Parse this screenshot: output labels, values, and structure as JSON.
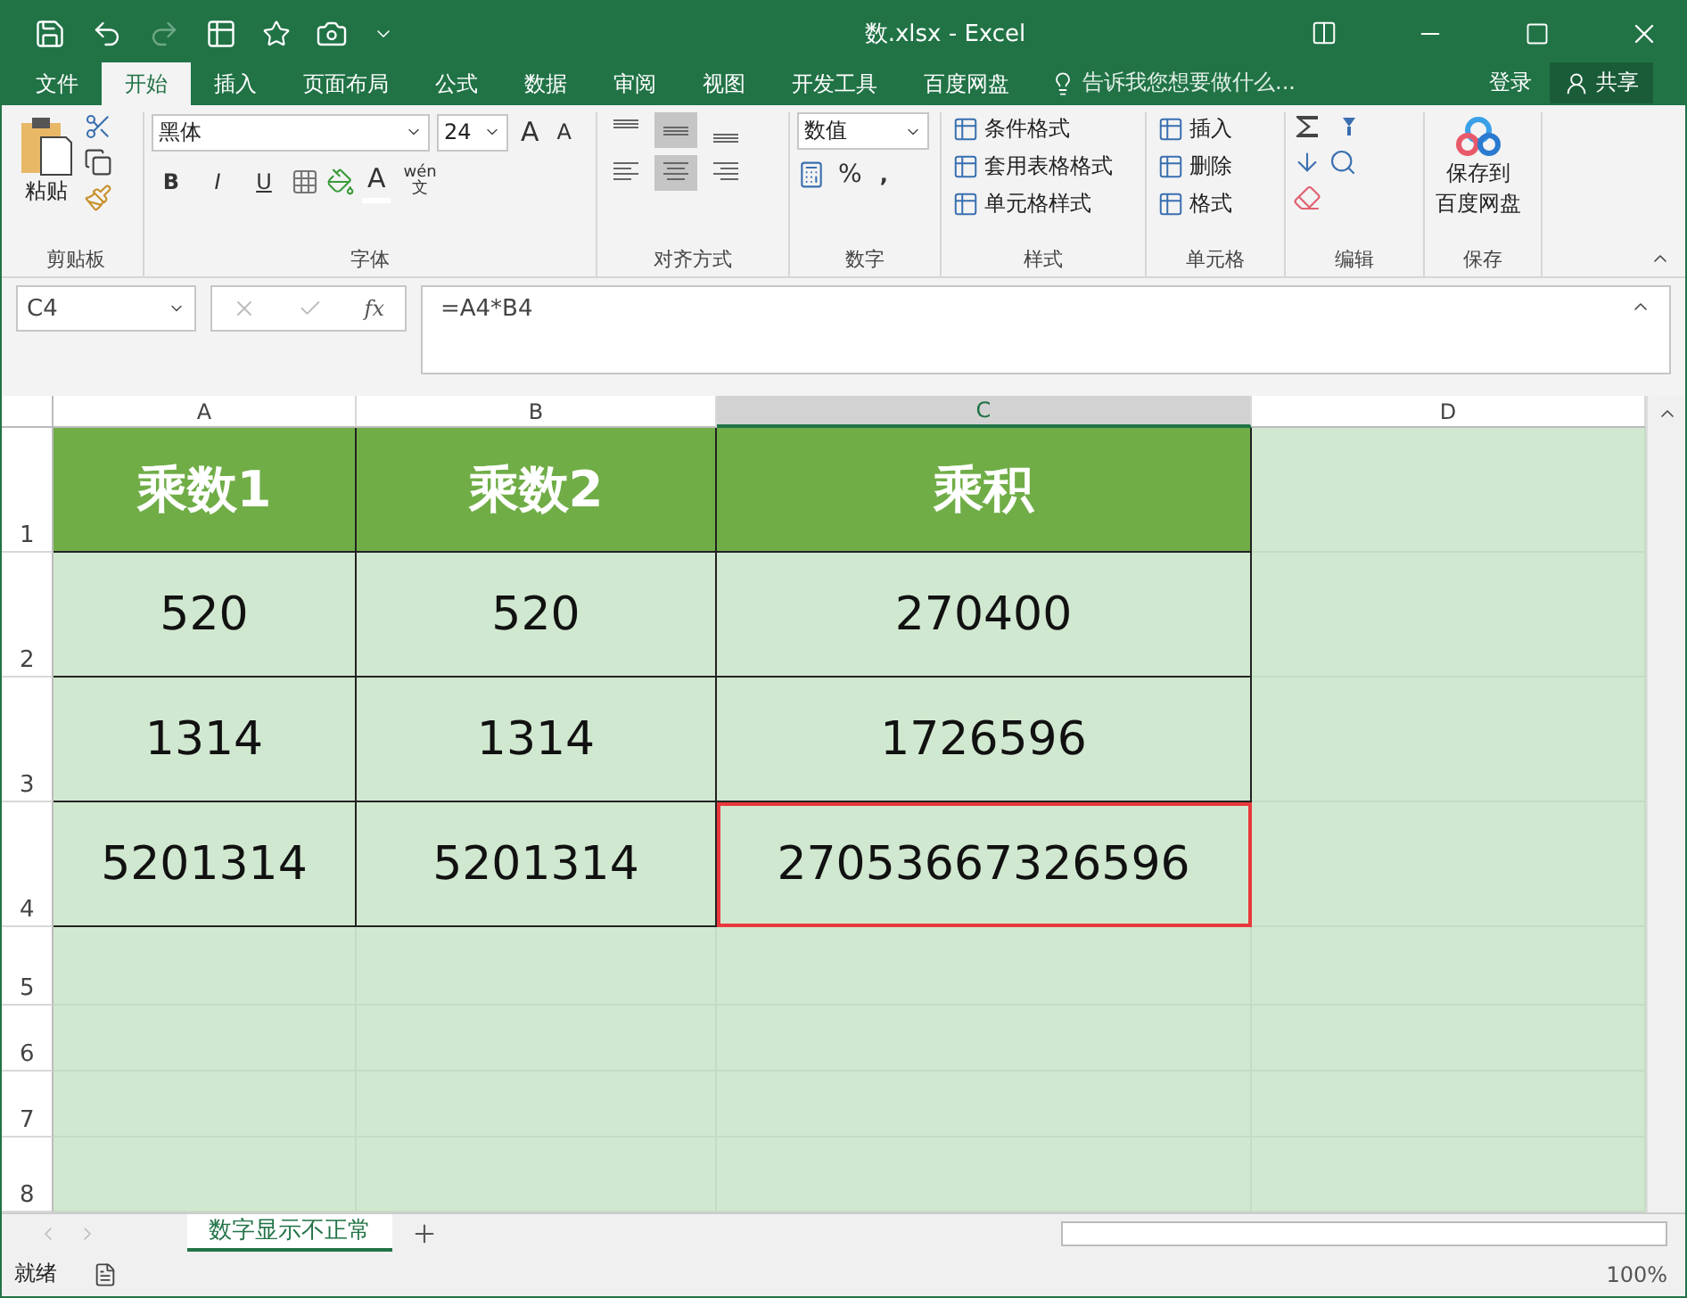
{
  "window": {
    "title": "数.xlsx - Excel"
  },
  "menu_tabs": [
    {
      "label": "文件",
      "selected": false
    },
    {
      "label": "开始",
      "selected": true
    },
    {
      "label": "插入",
      "selected": false
    },
    {
      "label": "页面布局",
      "selected": false
    },
    {
      "label": "公式",
      "selected": false
    },
    {
      "label": "数据",
      "selected": false
    },
    {
      "label": "审阅",
      "selected": false
    },
    {
      "label": "视图",
      "selected": false
    },
    {
      "label": "开发工具",
      "selected": false
    },
    {
      "label": "百度网盘",
      "selected": false
    }
  ],
  "tell_me": "告诉我您想要做什么...",
  "sign_in": "登录",
  "share": "共享",
  "clipboard": {
    "label": "剪贴板",
    "paste": "粘贴"
  },
  "font": {
    "label": "字体",
    "font_name": "黑体",
    "font_size": "24",
    "grow": "A",
    "shrink": "A",
    "styles": [
      "B",
      "I",
      "U"
    ],
    "font_color": "A",
    "phonetic_top": "wén",
    "phonetic_bottom": "文"
  },
  "alignment": {
    "label": "对齐方式",
    "vertical": [
      {
        "selected": false
      },
      {
        "selected": true
      },
      {
        "selected": false
      }
    ],
    "horizontal": [
      {
        "selected": false
      },
      {
        "selected": true
      },
      {
        "selected": false
      }
    ]
  },
  "number": {
    "label": "数字",
    "format": "数值",
    "percent": "%",
    "comma": ","
  },
  "styles": {
    "label": "样式",
    "items": [
      "条件格式",
      "套用表格格式",
      "单元格样式"
    ]
  },
  "cells": {
    "label": "单元格",
    "items": [
      "插入",
      "删除",
      "格式"
    ]
  },
  "editing": {
    "label": "编辑"
  },
  "save": {
    "label": "保存",
    "button_lines": [
      "保存到",
      "百度网盘"
    ]
  },
  "formula_bar": {
    "name_box": "C4",
    "fx": "fx",
    "formula": "=A4*B4"
  },
  "columns": [
    {
      "label": "A",
      "selected": false
    },
    {
      "label": "B",
      "selected": false
    },
    {
      "label": "C",
      "selected": true
    },
    {
      "label": "D",
      "selected": false
    }
  ],
  "rows": [
    {
      "number": "1",
      "kind": "header",
      "cells": [
        {
          "text": "乘数1",
          "selected": false
        },
        {
          "text": "乘数2",
          "selected": false
        },
        {
          "text": "乘积",
          "selected": false
        }
      ]
    },
    {
      "number": "2",
      "kind": "value",
      "cells": [
        {
          "text": "520",
          "selected": false
        },
        {
          "text": "520",
          "selected": false
        },
        {
          "text": "270400",
          "selected": false
        }
      ]
    },
    {
      "number": "3",
      "kind": "value",
      "cells": [
        {
          "text": "1314",
          "selected": false
        },
        {
          "text": "1314",
          "selected": false
        },
        {
          "text": "1726596",
          "selected": false
        }
      ]
    },
    {
      "number": "4",
      "kind": "value",
      "cells": [
        {
          "text": "5201314",
          "selected": false
        },
        {
          "text": "5201314",
          "selected": false
        },
        {
          "text": "27053667326596",
          "selected": true
        }
      ]
    },
    {
      "number": "5"
    },
    {
      "number": "6"
    },
    {
      "number": "7"
    },
    {
      "number": "8"
    }
  ],
  "sheet_tabs": [
    {
      "label": "数字显示不正常",
      "selected": true
    }
  ],
  "status_bar": {
    "status": "就绪",
    "zoom": "100%"
  }
}
